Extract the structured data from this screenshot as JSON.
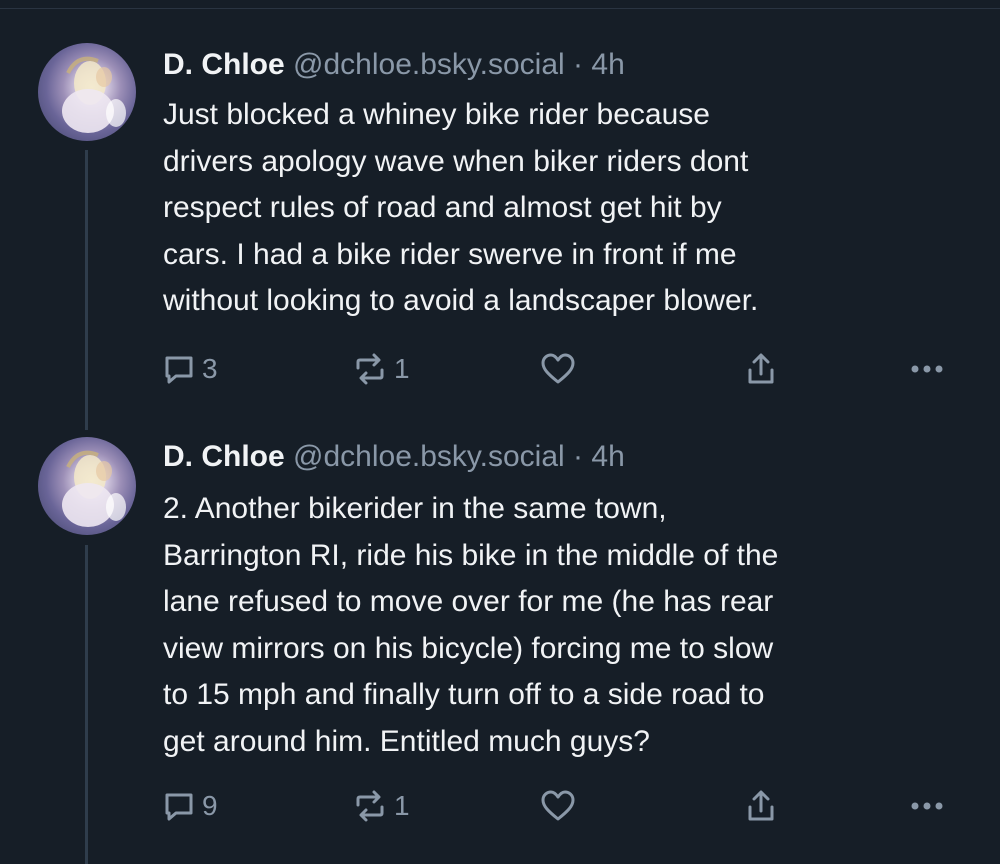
{
  "posts": [
    {
      "author": {
        "display_name": "D. Chloe",
        "handle": "@dchloe.bsky.social",
        "separator": "·",
        "time": "4h"
      },
      "lines": [
        "Just blocked a whiney bike rider because",
        "drivers apology wave when biker riders dont",
        "respect rules of road and almost get hit by",
        "cars. I had a bike rider swerve in front if me",
        "without looking to avoid a landscaper blower."
      ],
      "actions": {
        "reply_icon": "reply-icon",
        "reply_count": "3",
        "repost_icon": "repost-icon",
        "repost_count": "1",
        "like_icon": "heart-icon",
        "share_icon": "share-icon",
        "more_icon": "more-icon"
      }
    },
    {
      "author": {
        "display_name": "D. Chloe",
        "handle": "@dchloe.bsky.social",
        "separator": "·",
        "time": "4h"
      },
      "lines": [
        "2. Another bikerider in the same town,",
        "Barrington RI, ride his bike in the middle of the",
        "lane refused to move over for me (he has rear",
        "view mirrors on his bicycle) forcing me to slow",
        "to 15 mph and finally turn off to a side road to",
        "get around him. Entitled much guys?"
      ],
      "actions": {
        "reply_icon": "reply-icon",
        "reply_count": "9",
        "repost_icon": "repost-icon",
        "repost_count": "1",
        "like_icon": "heart-icon",
        "share_icon": "share-icon",
        "more_icon": "more-icon"
      }
    }
  ],
  "colors": {
    "background": "#161e27",
    "text": "#f1f3f5",
    "muted": "#8a98a8",
    "thread_line": "#2f3d4c"
  }
}
